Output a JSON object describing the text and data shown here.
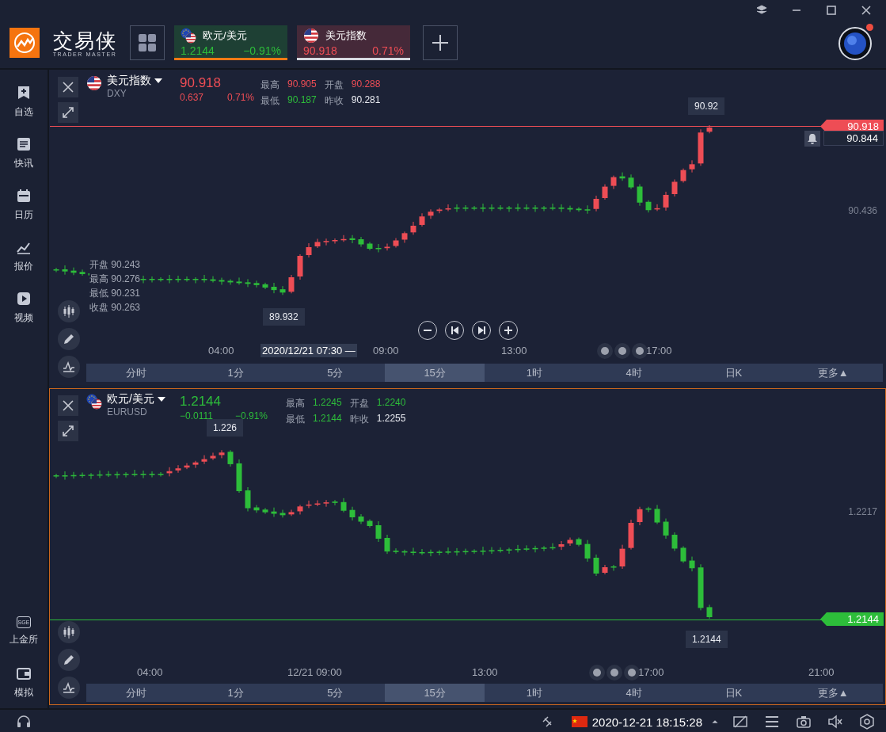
{
  "app": {
    "logo_text": "交易侠",
    "logo_subtitle": "TRADER MASTER"
  },
  "watch_tabs": [
    {
      "flag": {
        "kind": "eu"
      },
      "name": "欧元/美元",
      "price": "1.2144",
      "change": "−0.91%",
      "color": "#2dbd3a",
      "selected": true
    },
    {
      "flag": {
        "kind": "us"
      },
      "name": "美元指数",
      "price": "90.918",
      "change": "0.71%",
      "color": "#ee4d55",
      "selected": false
    }
  ],
  "user": {
    "has_notification": true
  },
  "sidebar": {
    "items": [
      {
        "kind": "bookmark",
        "label": "自选"
      },
      {
        "kind": "news",
        "label": "快讯"
      },
      {
        "kind": "calendar",
        "label": "日历"
      },
      {
        "kind": "quote",
        "label": "报价"
      },
      {
        "kind": "video",
        "label": "视频"
      }
    ],
    "bottom_items": [
      {
        "kind": "exchange",
        "icon_text": "SGE",
        "label": "上金所"
      },
      {
        "kind": "wallet",
        "label": "模拟"
      }
    ]
  },
  "charts": [
    {
      "flag": {
        "kind": "us"
      },
      "name": "美元指数",
      "code": "DXY",
      "price": "90.918",
      "change": "0.637",
      "change_pct": "0.71%",
      "color": "#ee4d55",
      "focused": false,
      "stats": [
        {
          "label": "最高",
          "value": "90.905",
          "color": "#ee4d55"
        },
        {
          "label": "开盘",
          "value": "90.288",
          "color": "#ee4d55"
        },
        {
          "label": "最低",
          "value": "90.187",
          "color": "#2dbd3a"
        },
        {
          "label": "昨收",
          "value": "90.281",
          "color": "#e8eaf0"
        }
      ],
      "ohlc_legend": [
        {
          "label": "开盘",
          "value": "90.243"
        },
        {
          "label": "最高",
          "value": "90.276"
        },
        {
          "label": "最低",
          "value": "90.231"
        },
        {
          "label": "收盘",
          "value": "90.263"
        }
      ],
      "markers": [
        "90.92",
        "89.932"
      ],
      "axis_label": "90.436",
      "price_tag": "90.918",
      "alert_tag": "90.844",
      "crosshair_time": "2020/12/21 07:30 —",
      "time_labels": [
        "04:00",
        "09:00",
        "13:00",
        "17:00"
      ],
      "zoom_buttons": [
        {
          "kind": "zoom_out"
        },
        {
          "kind": "skip_back"
        },
        {
          "kind": "skip_forward"
        },
        {
          "kind": "zoom_in"
        }
      ],
      "periods": [
        {
          "label": "分时",
          "selected": false
        },
        {
          "label": "1分",
          "selected": false
        },
        {
          "label": "5分",
          "selected": false
        },
        {
          "label": "15分",
          "selected": true
        },
        {
          "label": "1时",
          "selected": false
        },
        {
          "label": "4时",
          "selected": false
        },
        {
          "label": "日K",
          "selected": false
        },
        {
          "label": "更多▲",
          "selected": false
        }
      ]
    },
    {
      "flag": {
        "kind": "eu"
      },
      "name": "欧元/美元",
      "code": "EURUSD",
      "price": "1.2144",
      "change": "−0.0111",
      "change_pct": "−0.91%",
      "color": "#2dbd3a",
      "focused": true,
      "stats": [
        {
          "label": "最高",
          "value": "1.2245",
          "color": "#2dbd3a"
        },
        {
          "label": "开盘",
          "value": "1.2240",
          "color": "#2dbd3a"
        },
        {
          "label": "最低",
          "value": "1.2144",
          "color": "#2dbd3a"
        },
        {
          "label": "昨收",
          "value": "1.2255",
          "color": "#e8eaf0"
        }
      ],
      "markers": [
        "1.226",
        "1.2144"
      ],
      "axis_label": "1.2217",
      "price_tag": "1.2144",
      "time_labels": [
        "04:00",
        "12/21 09:00",
        "13:00",
        "17:00",
        "21:00"
      ],
      "periods": [
        {
          "label": "分时",
          "selected": false
        },
        {
          "label": "1分",
          "selected": false
        },
        {
          "label": "5分",
          "selected": false
        },
        {
          "label": "15分",
          "selected": true
        },
        {
          "label": "1时",
          "selected": false
        },
        {
          "label": "4时",
          "selected": false
        },
        {
          "label": "日K",
          "selected": false
        },
        {
          "label": "更多▲",
          "selected": false
        }
      ]
    }
  ],
  "status_bar": {
    "datetime": "2020-12-21 18:15:28"
  }
}
